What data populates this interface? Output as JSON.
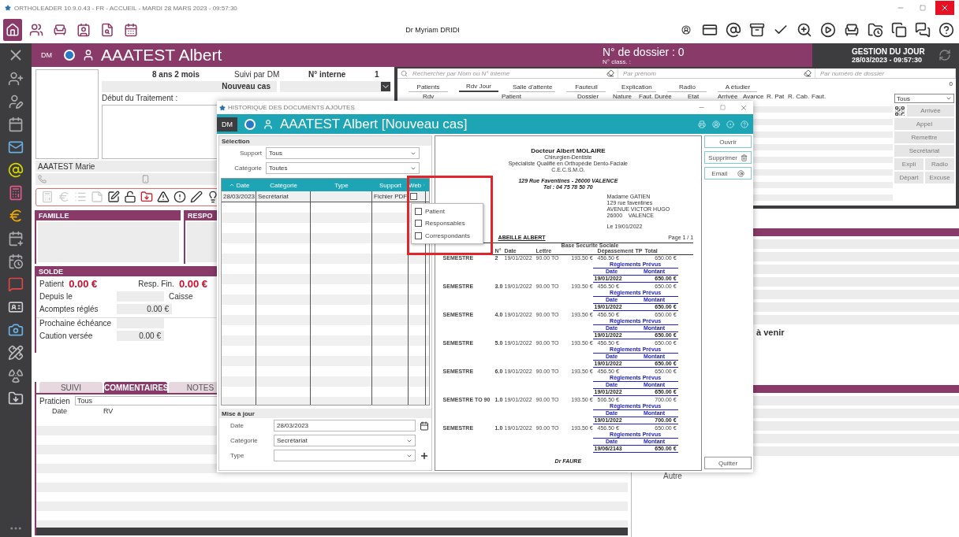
{
  "app_title": "ORTHOLEADER 10.9.0.43 - FR - ACCUEIL - MARDI 28 MARS 2023 - 09:57:30",
  "toolbar": {
    "user": "Dr Myriam DRIDI"
  },
  "header": {
    "initials": "DM",
    "patient_name": "AAATEST Albert",
    "dossier": "N° de dossier : 0",
    "class_label": "N° class. :",
    "day_title": "GESTION DU JOUR",
    "day_datetime": "28/03/2023 - 09:57:30"
  },
  "patient": {
    "age": "8 ans 2 mois",
    "followed_by": "Suivi par DM",
    "internal_label": "N° interne",
    "internal_number": "1",
    "case": "Nouveau cas",
    "start_label": "Début du Traitement :",
    "parent": "AAATEST Marie"
  },
  "famille": {
    "title": "FAMILLE",
    "responsables_title": "RESPO"
  },
  "solde": {
    "title": "SOLDE",
    "patient_label": "Patient",
    "patient_amount": "0.00 €",
    "resp_label": "Resp. Fin.",
    "resp_amount": "0.00 €",
    "since_label": "Depuis le",
    "caisse_label": "Caisse",
    "paid_label": "Acomptes réglés",
    "paid_value": "0.00 €",
    "next_label": "Prochaine échéance",
    "deposit_label": "Caution versée",
    "deposit_value": "0.00 €"
  },
  "notes": {
    "tabs": [
      {
        "label": "SUIVI",
        "selected": false
      },
      {
        "label": "COMMENTAIRES",
        "selected": true
      },
      {
        "label": "NOTES",
        "selected": false
      }
    ],
    "practitioner_label": "Praticien",
    "practitioner": "Tous",
    "columns": [
      "Date",
      "RV"
    ]
  },
  "appointments": {
    "search": [
      {
        "placeholder": "Rechercher par Nom ou N° interne"
      },
      {
        "placeholder": "Par prénom"
      },
      {
        "placeholder": "Par numéro de dossier"
      }
    ],
    "tabs": [
      {
        "label": "Patients",
        "selected": false
      },
      {
        "label": "Rdv Jour",
        "selected": true
      },
      {
        "label": "Salle d'attente",
        "selected": false
      },
      {
        "label": "Fauteuil",
        "selected": false
      },
      {
        "label": "Explication",
        "selected": false
      },
      {
        "label": "Radio",
        "selected": false
      },
      {
        "label": "A étudier",
        "selected": false
      }
    ],
    "count": "0",
    "columns": [
      "Rdv",
      "Patient",
      "Dossier",
      "Nature",
      "Faut.",
      "Durée",
      "Etat",
      "Arrivée",
      "Avance",
      "R. Pat",
      "R. Cab.",
      "Faut."
    ],
    "filter": "Tous",
    "actions": [
      {
        "label": "Arrivée",
        "disabled": true
      },
      {
        "label": "Appel",
        "disabled": true
      },
      {
        "label": "Remettre",
        "disabled": true
      },
      {
        "label": "Secrétariat",
        "disabled": true
      },
      {
        "label": "Expli",
        "disabled": true
      },
      {
        "label": "Radio",
        "disabled": true
      },
      {
        "label": "Départ",
        "disabled": true
      },
      {
        "label": "Excuse",
        "disabled": true
      }
    ]
  },
  "lower_right": {
    "upcoming": "à venir",
    "other": "Autre"
  },
  "dialog": {
    "title": "HISTORIQUE DES DOCUMENTS AJOUTES",
    "initials": "DM",
    "patient_name": "AAATEST Albert",
    "case": "[Nouveau cas]",
    "selection": {
      "title": "Sélection",
      "fields": [
        {
          "label": "Support",
          "value": "Tous"
        },
        {
          "label": "Catégorie",
          "value": "Toutes"
        }
      ]
    },
    "columns": [
      "Date",
      "Catégorie",
      "Type",
      "Support",
      "Web"
    ],
    "rows": [
      {
        "date": "28/03/2023",
        "category": "Secrétariat",
        "support": "Fichier PDF",
        "web": false
      }
    ],
    "web_menu": [
      {
        "label": "Patient",
        "checked": false
      },
      {
        "label": "Responsables",
        "checked": false
      },
      {
        "label": "Correspondants",
        "checked": false
      }
    ],
    "update": {
      "title": "Mise à jour",
      "date_label": "Date",
      "date": "28/03/2023",
      "category_label": "Catégorie",
      "category": "Secrétariat",
      "type_label": "Type"
    },
    "buttons": [
      {
        "label": "Ouvrir",
        "kind": "plain"
      },
      {
        "label": "Supprimer",
        "kind": "delete"
      },
      {
        "label": "Email",
        "kind": "email"
      }
    ],
    "close_button": "Quitter"
  },
  "document": {
    "doctor": "Docteur Albert MOLAIRE",
    "lines": [
      "Chirurgien-Dentiste",
      "Spécialiste Qualifié en Orthopédie Dento-Faciale",
      "C.E.C.S.M.O."
    ],
    "address": "129 Rue Faventines - 26000 VALENCE",
    "phone": "Tel : 04 75 78 50 70",
    "recipient": [
      "Madame GATIEN",
      "129 rue faventines",
      "AVENUE VICTOR HUGO",
      "26000    VALENCE"
    ],
    "date": "Le 19/01/2022",
    "patient": "ABEILLE ALBERT",
    "page": "Page 1 / 1",
    "group_header": "Base Securite Sociale",
    "columns": [
      "N°",
      "Date",
      "Lettre",
      "Dépassement",
      "TP",
      "Total"
    ],
    "entries": [
      {
        "label": "SEMESTRE",
        "n": "2",
        "date": "19/01/2022",
        "letter": "90.00 TO",
        "base": "193.50 €",
        "over": "456.50 €",
        "total": "650.00 €",
        "plan_title": "Règlements Prévus",
        "plan_date_label": "Date",
        "plan_amount_label": "Montant",
        "plan_date": "19/01/2022",
        "plan_amount": "650.00 €"
      },
      {
        "label": "SEMESTRE",
        "n": "3.0",
        "date": "19/01/2022",
        "letter": "90.00 TO",
        "base": "193.50 €",
        "over": "456.50 €",
        "total": "650.00 €",
        "plan_title": "Règlements Prévus",
        "plan_date_label": "Date",
        "plan_amount_label": "Montant",
        "plan_date": "19/01/2022",
        "plan_amount": "650.00 €"
      },
      {
        "label": "SEMESTRE",
        "n": "4.0",
        "date": "19/01/2022",
        "letter": "90.00 TO",
        "base": "193.50 €",
        "over": "456.50 €",
        "total": "650.00 €",
        "plan_title": "Règlements Prévus",
        "plan_date_label": "Date",
        "plan_amount_label": "Montant",
        "plan_date": "19/01/2022",
        "plan_amount": "650.00 €"
      },
      {
        "label": "SEMESTRE",
        "n": "5.0",
        "date": "19/01/2022",
        "letter": "90.00 TO",
        "base": "193.50 €",
        "over": "456.50 €",
        "total": "650.00 €",
        "plan_title": "Règlements Prévus",
        "plan_date_label": "Date",
        "plan_amount_label": "Montant",
        "plan_date": "19/01/2022",
        "plan_amount": "650.00 €"
      },
      {
        "label": "SEMESTRE",
        "n": "6.0",
        "date": "19/01/2022",
        "letter": "90.00 TO",
        "base": "193.50 €",
        "over": "456.50 €",
        "total": "650.00 €",
        "plan_title": "Règlements Prévus",
        "plan_date_label": "Date",
        "plan_amount_label": "Montant",
        "plan_date": "19/01/2022",
        "plan_amount": "650.00 €"
      },
      {
        "label": "SEMESTRE TO 90",
        "n": "1.0",
        "date": "19/01/2022",
        "letter": "90.00 TO",
        "base": "193.50 €",
        "over": "506.50 €",
        "total": "700.00 €",
        "plan_title": "Règlements Prévus",
        "plan_date_label": "Date",
        "plan_amount_label": "Montant",
        "plan_date": "19/01/2022",
        "plan_amount": "700.00 €"
      },
      {
        "label": "SEMESTRE",
        "n": "1.0",
        "date": "19/01/2022",
        "letter": "90.00 TO",
        "base": "193.50 €",
        "over": "456.50 €",
        "total": "650.00 €",
        "plan_title": "Règlements Prévus",
        "plan_date_label": "Date",
        "plan_amount_label": "Montant",
        "plan_date": "19/06/2143",
        "plan_amount": "650.00 €"
      }
    ],
    "signature": "Dr FAURE"
  }
}
